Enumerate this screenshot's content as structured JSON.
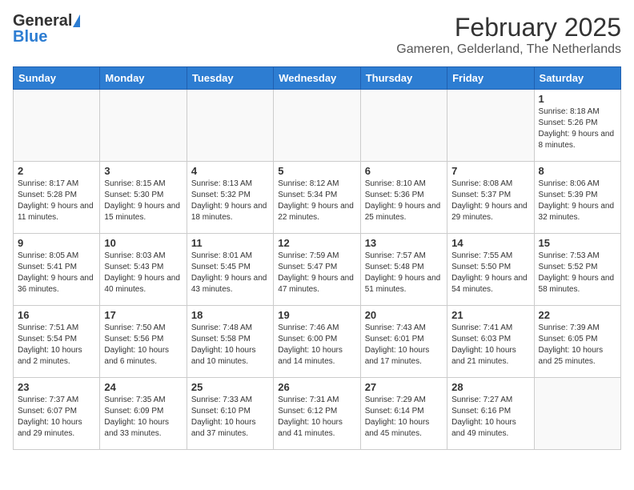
{
  "header": {
    "logo_general": "General",
    "logo_blue": "Blue",
    "month_title": "February 2025",
    "location": "Gameren, Gelderland, The Netherlands"
  },
  "weekdays": [
    "Sunday",
    "Monday",
    "Tuesday",
    "Wednesday",
    "Thursday",
    "Friday",
    "Saturday"
  ],
  "weeks": [
    [
      {
        "day": "",
        "info": ""
      },
      {
        "day": "",
        "info": ""
      },
      {
        "day": "",
        "info": ""
      },
      {
        "day": "",
        "info": ""
      },
      {
        "day": "",
        "info": ""
      },
      {
        "day": "",
        "info": ""
      },
      {
        "day": "1",
        "info": "Sunrise: 8:18 AM\nSunset: 5:26 PM\nDaylight: 9 hours and 8 minutes."
      }
    ],
    [
      {
        "day": "2",
        "info": "Sunrise: 8:17 AM\nSunset: 5:28 PM\nDaylight: 9 hours and 11 minutes."
      },
      {
        "day": "3",
        "info": "Sunrise: 8:15 AM\nSunset: 5:30 PM\nDaylight: 9 hours and 15 minutes."
      },
      {
        "day": "4",
        "info": "Sunrise: 8:13 AM\nSunset: 5:32 PM\nDaylight: 9 hours and 18 minutes."
      },
      {
        "day": "5",
        "info": "Sunrise: 8:12 AM\nSunset: 5:34 PM\nDaylight: 9 hours and 22 minutes."
      },
      {
        "day": "6",
        "info": "Sunrise: 8:10 AM\nSunset: 5:36 PM\nDaylight: 9 hours and 25 minutes."
      },
      {
        "day": "7",
        "info": "Sunrise: 8:08 AM\nSunset: 5:37 PM\nDaylight: 9 hours and 29 minutes."
      },
      {
        "day": "8",
        "info": "Sunrise: 8:06 AM\nSunset: 5:39 PM\nDaylight: 9 hours and 32 minutes."
      }
    ],
    [
      {
        "day": "9",
        "info": "Sunrise: 8:05 AM\nSunset: 5:41 PM\nDaylight: 9 hours and 36 minutes."
      },
      {
        "day": "10",
        "info": "Sunrise: 8:03 AM\nSunset: 5:43 PM\nDaylight: 9 hours and 40 minutes."
      },
      {
        "day": "11",
        "info": "Sunrise: 8:01 AM\nSunset: 5:45 PM\nDaylight: 9 hours and 43 minutes."
      },
      {
        "day": "12",
        "info": "Sunrise: 7:59 AM\nSunset: 5:47 PM\nDaylight: 9 hours and 47 minutes."
      },
      {
        "day": "13",
        "info": "Sunrise: 7:57 AM\nSunset: 5:48 PM\nDaylight: 9 hours and 51 minutes."
      },
      {
        "day": "14",
        "info": "Sunrise: 7:55 AM\nSunset: 5:50 PM\nDaylight: 9 hours and 54 minutes."
      },
      {
        "day": "15",
        "info": "Sunrise: 7:53 AM\nSunset: 5:52 PM\nDaylight: 9 hours and 58 minutes."
      }
    ],
    [
      {
        "day": "16",
        "info": "Sunrise: 7:51 AM\nSunset: 5:54 PM\nDaylight: 10 hours and 2 minutes."
      },
      {
        "day": "17",
        "info": "Sunrise: 7:50 AM\nSunset: 5:56 PM\nDaylight: 10 hours and 6 minutes."
      },
      {
        "day": "18",
        "info": "Sunrise: 7:48 AM\nSunset: 5:58 PM\nDaylight: 10 hours and 10 minutes."
      },
      {
        "day": "19",
        "info": "Sunrise: 7:46 AM\nSunset: 6:00 PM\nDaylight: 10 hours and 14 minutes."
      },
      {
        "day": "20",
        "info": "Sunrise: 7:43 AM\nSunset: 6:01 PM\nDaylight: 10 hours and 17 minutes."
      },
      {
        "day": "21",
        "info": "Sunrise: 7:41 AM\nSunset: 6:03 PM\nDaylight: 10 hours and 21 minutes."
      },
      {
        "day": "22",
        "info": "Sunrise: 7:39 AM\nSunset: 6:05 PM\nDaylight: 10 hours and 25 minutes."
      }
    ],
    [
      {
        "day": "23",
        "info": "Sunrise: 7:37 AM\nSunset: 6:07 PM\nDaylight: 10 hours and 29 minutes."
      },
      {
        "day": "24",
        "info": "Sunrise: 7:35 AM\nSunset: 6:09 PM\nDaylight: 10 hours and 33 minutes."
      },
      {
        "day": "25",
        "info": "Sunrise: 7:33 AM\nSunset: 6:10 PM\nDaylight: 10 hours and 37 minutes."
      },
      {
        "day": "26",
        "info": "Sunrise: 7:31 AM\nSunset: 6:12 PM\nDaylight: 10 hours and 41 minutes."
      },
      {
        "day": "27",
        "info": "Sunrise: 7:29 AM\nSunset: 6:14 PM\nDaylight: 10 hours and 45 minutes."
      },
      {
        "day": "28",
        "info": "Sunrise: 7:27 AM\nSunset: 6:16 PM\nDaylight: 10 hours and 49 minutes."
      },
      {
        "day": "",
        "info": ""
      }
    ]
  ]
}
